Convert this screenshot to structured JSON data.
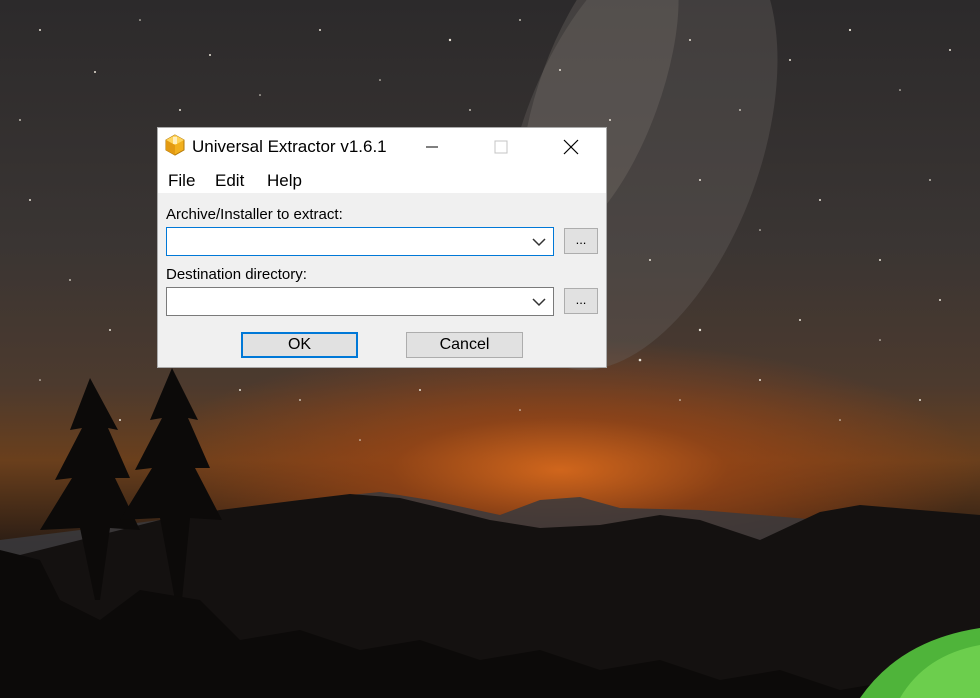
{
  "window": {
    "title": "Universal Extractor v1.6.1",
    "icon": "universal-extractor-app-icon",
    "controls": [
      "minimize-icon",
      "maximize-icon",
      "close-icon"
    ]
  },
  "menu": {
    "file": "File",
    "edit": "Edit",
    "help": "Help"
  },
  "form": {
    "archive_label": "Archive/Installer to extract:",
    "archive_value": "",
    "destination_label": "Destination directory:",
    "destination_value": "",
    "browse_label": "..."
  },
  "buttons": {
    "ok": "OK",
    "cancel": "Cancel"
  },
  "colors": {
    "accent": "#0078d7",
    "dialog_bg": "#f0f0f0",
    "button_bg": "#e1e1e1"
  }
}
